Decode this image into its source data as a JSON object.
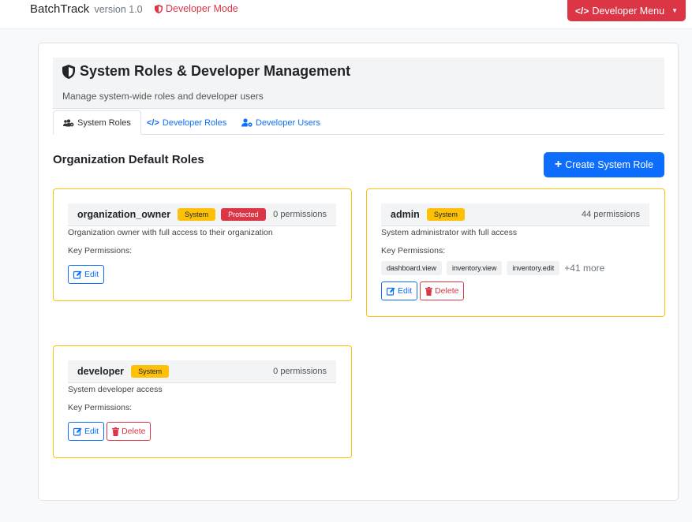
{
  "navbar": {
    "brand": "BatchTrack",
    "version": "version 1.0",
    "dev_mode": "Developer Mode",
    "dev_menu": "Developer Menu"
  },
  "header": {
    "title": "System Roles & Developer Management",
    "subtitle": "Manage system-wide roles and developer users"
  },
  "tabs": [
    {
      "label": "System Roles",
      "active": true
    },
    {
      "label": "Developer Roles",
      "active": false
    },
    {
      "label": "Developer Users",
      "active": false
    }
  ],
  "section": {
    "title": "Organization Default Roles",
    "create_label": "Create System Role"
  },
  "roles": [
    {
      "name": "organization_owner",
      "badges": [
        "System",
        "Protected"
      ],
      "permissions": "0 permissions",
      "description": "Organization owner with full access to their organization",
      "key_permissions_label": "Key Permissions:",
      "edit_label": "Edit"
    },
    {
      "name": "admin",
      "badges": [
        "System"
      ],
      "permissions": "44 permissions",
      "description": "System administrator with full access",
      "key_permissions_label": "Key Permissions:",
      "tags": [
        "dashboard.view",
        "inventory.view",
        "inventory.edit"
      ],
      "more": "+41 more",
      "edit_label": "Edit",
      "delete_label": "Delete"
    },
    {
      "name": "developer",
      "badges": [
        "System"
      ],
      "permissions": "0 permissions",
      "description": "System developer access",
      "key_permissions_label": "Key Permissions:",
      "edit_label": "Edit",
      "delete_label": "Delete"
    }
  ],
  "colors": {
    "primary": "#0d6efd",
    "danger": "#dc3545",
    "warning": "#ffc107"
  },
  "icons": {
    "dev_mode": "shield-icon",
    "dev_menu": "code-icon",
    "title": "shield-icon",
    "tab_system_roles": "users-cog-icon",
    "tab_developer_roles": "code-icon",
    "tab_developer_users": "user-cog-icon",
    "create": "plus-icon",
    "edit": "edit-icon",
    "delete": "trash-icon"
  }
}
